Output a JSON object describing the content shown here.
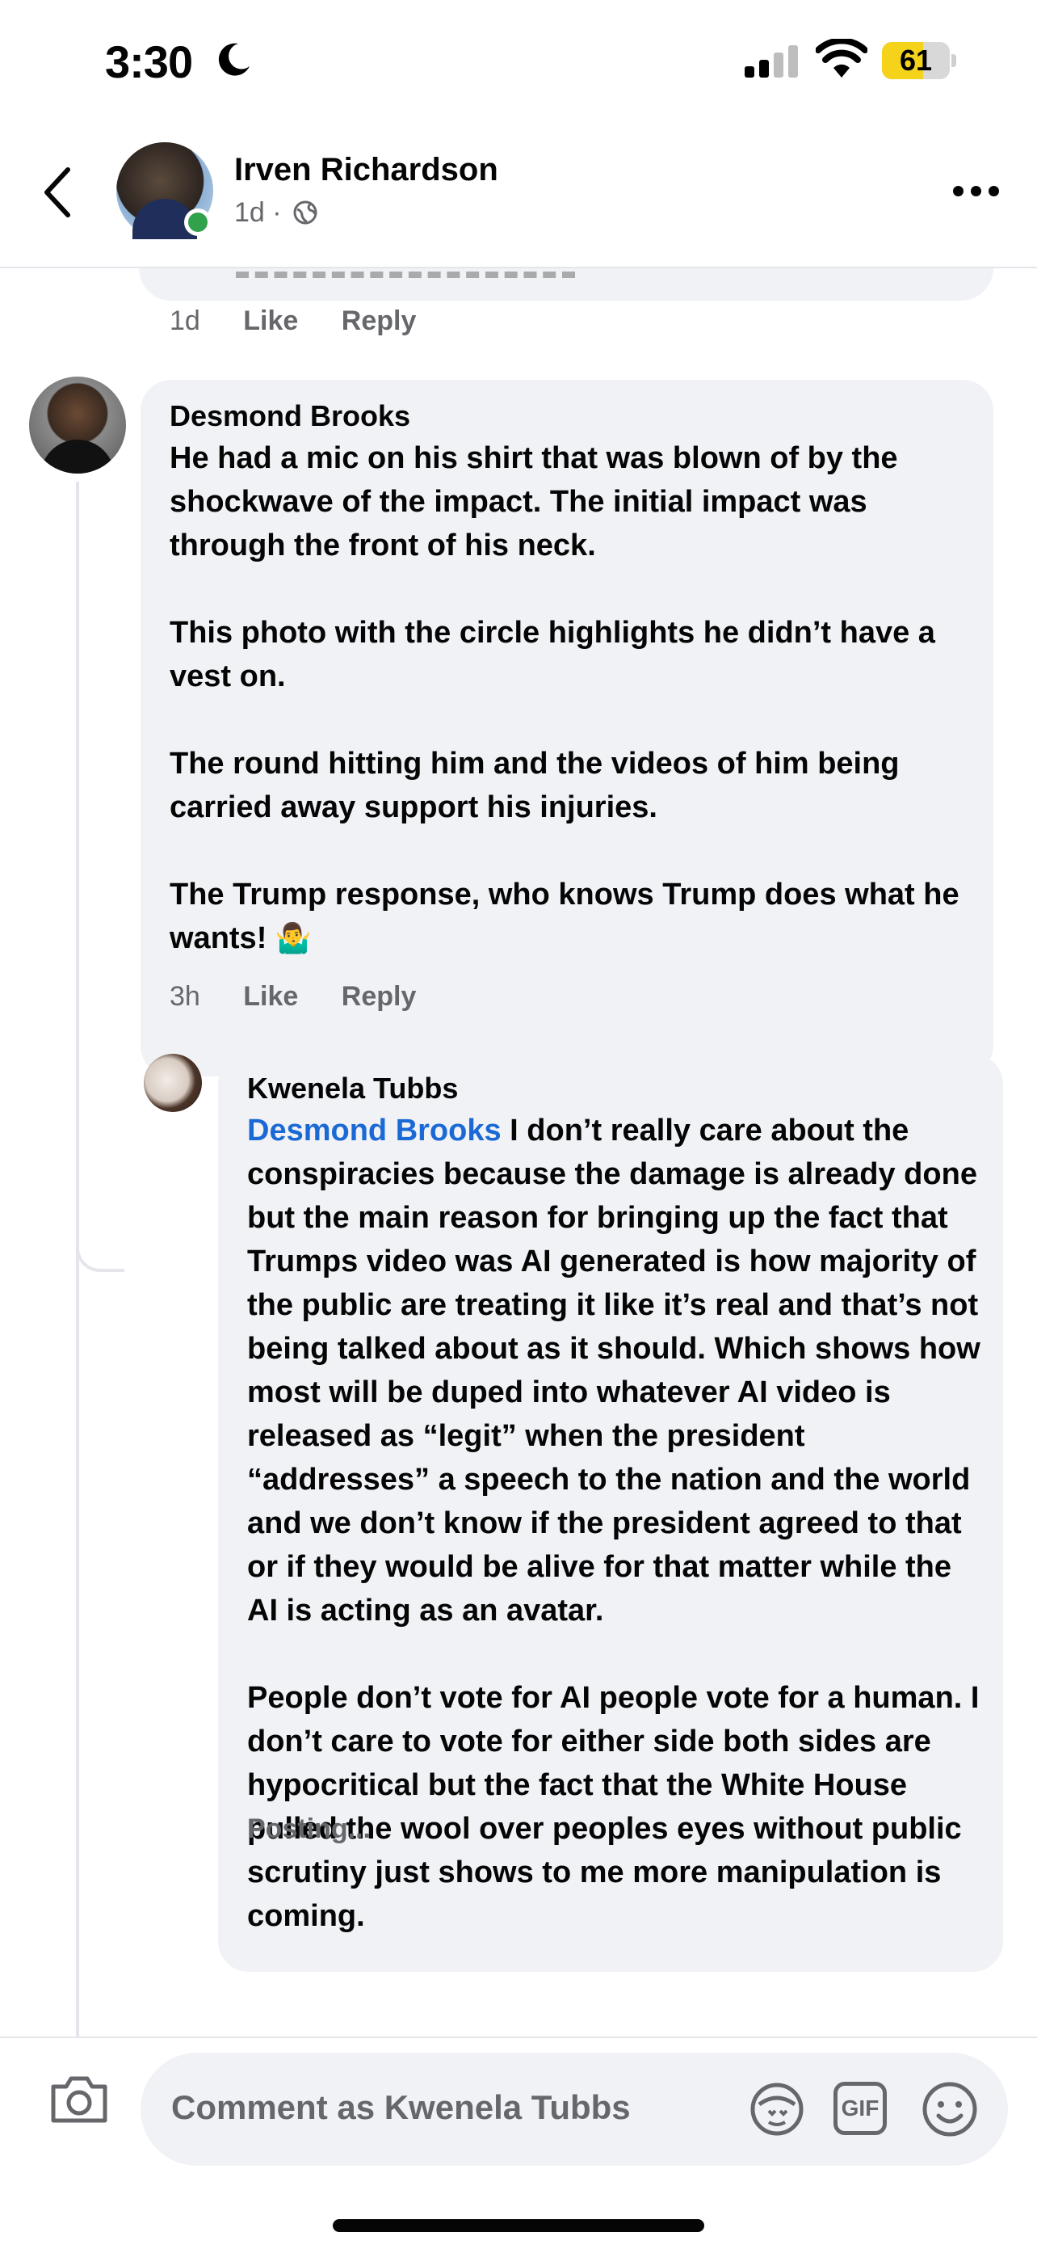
{
  "status_bar": {
    "time": "3:30",
    "battery_level": "61",
    "battery_fraction": 0.61,
    "icons": [
      "moon-icon",
      "cellular-signal-icon",
      "wifi-icon",
      "battery-icon"
    ]
  },
  "header": {
    "name": "Irven Richardson",
    "meta": "1d ·",
    "icons": [
      "back-chevron-icon",
      "globe-icon",
      "more-dots-icon"
    ]
  },
  "previous_comment": {
    "time": "1d",
    "like": "Like",
    "reply": "Reply"
  },
  "comments": [
    {
      "author": "Desmond Brooks",
      "text": "He had a mic on his shirt that was blown of by the shockwave of the impact. The initial impact was through the front of his neck.\n\nThis photo with the circle highlights he didn’t have a vest on.\n\nThe round hitting him and the videos of him being carried away support his injuries.\n\nThe Trump response, who knows Trump does what he wants! ",
      "emoji": "🤷‍♂️",
      "time": "3h",
      "like": "Like",
      "reply": "Reply"
    },
    {
      "author": "Kwenela Tubbs",
      "mention": "Desmond Brooks",
      "text": " I don’t really care about the conspiracies because the damage is already done but the main reason for bringing up the fact that Trumps video was AI generated is how majority of the public are treating it like it’s real and that’s not being talked about as it should. Which shows how most will be duped into whatever AI video is released as “legit” when the president “addresses” a speech to the nation and the world and we don’t know if the president agreed to that or if they would be alive for that matter while the AI is acting as an avatar.\n\nPeople don’t vote for AI people vote for a human. I don’t care to vote for either side both sides are hypocritical but the fact that the White House pulled the wool over peoples eyes without public scrutiny just shows to me more manipulation is coming.",
      "status": "Posting..."
    }
  ],
  "composer": {
    "placeholder": "Comment as Kwenela Tubbs",
    "gif_label": "GIF",
    "icons": [
      "camera-icon",
      "avatar-sticker-icon",
      "gif-icon",
      "emoji-icon"
    ]
  },
  "colors": {
    "bubble": "#f0f2f5",
    "secondary_text": "#65676b",
    "mention": "#1b69d4",
    "online": "#31a24c",
    "battery": "#f5d31b"
  }
}
